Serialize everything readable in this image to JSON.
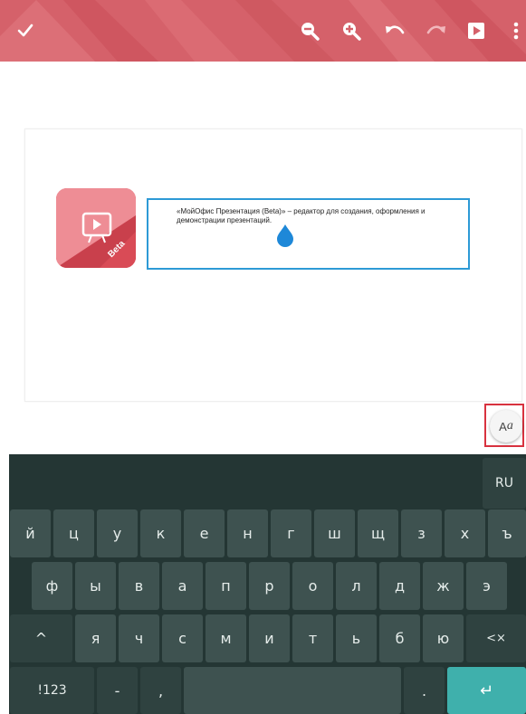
{
  "toolbar": {
    "bg_color": "#d5616a",
    "icons": [
      "check-icon",
      "zoom-out-icon",
      "zoom-in-icon",
      "undo-icon",
      "redo-icon",
      "play-icon",
      "more-icon"
    ]
  },
  "slide": {
    "logo_badge": "Beta",
    "text": "«МойОфис Презентация (Beta)» – редактор для создания, оформления и демонстрации презентаций."
  },
  "format_button": {
    "label_a": "A",
    "label_a_italic": "a"
  },
  "keyboard": {
    "lang_key": "RU",
    "row1": [
      "й",
      "ц",
      "у",
      "к",
      "е",
      "н",
      "г",
      "ш",
      "щ",
      "з",
      "х",
      "ъ"
    ],
    "row2": [
      "ф",
      "ы",
      "в",
      "а",
      "п",
      "р",
      "о",
      "л",
      "д",
      "ж",
      "э"
    ],
    "shift_key": "^",
    "row3": [
      "я",
      "ч",
      "с",
      "м",
      "и",
      "т",
      "ь",
      "б",
      "ю"
    ],
    "backspace_key": "<×",
    "symbols_key": "!123",
    "dash_key": "-",
    "comma_key": ",",
    "period_key": ".",
    "enter_key": "↵",
    "accent_color": "#3fb0ac"
  }
}
